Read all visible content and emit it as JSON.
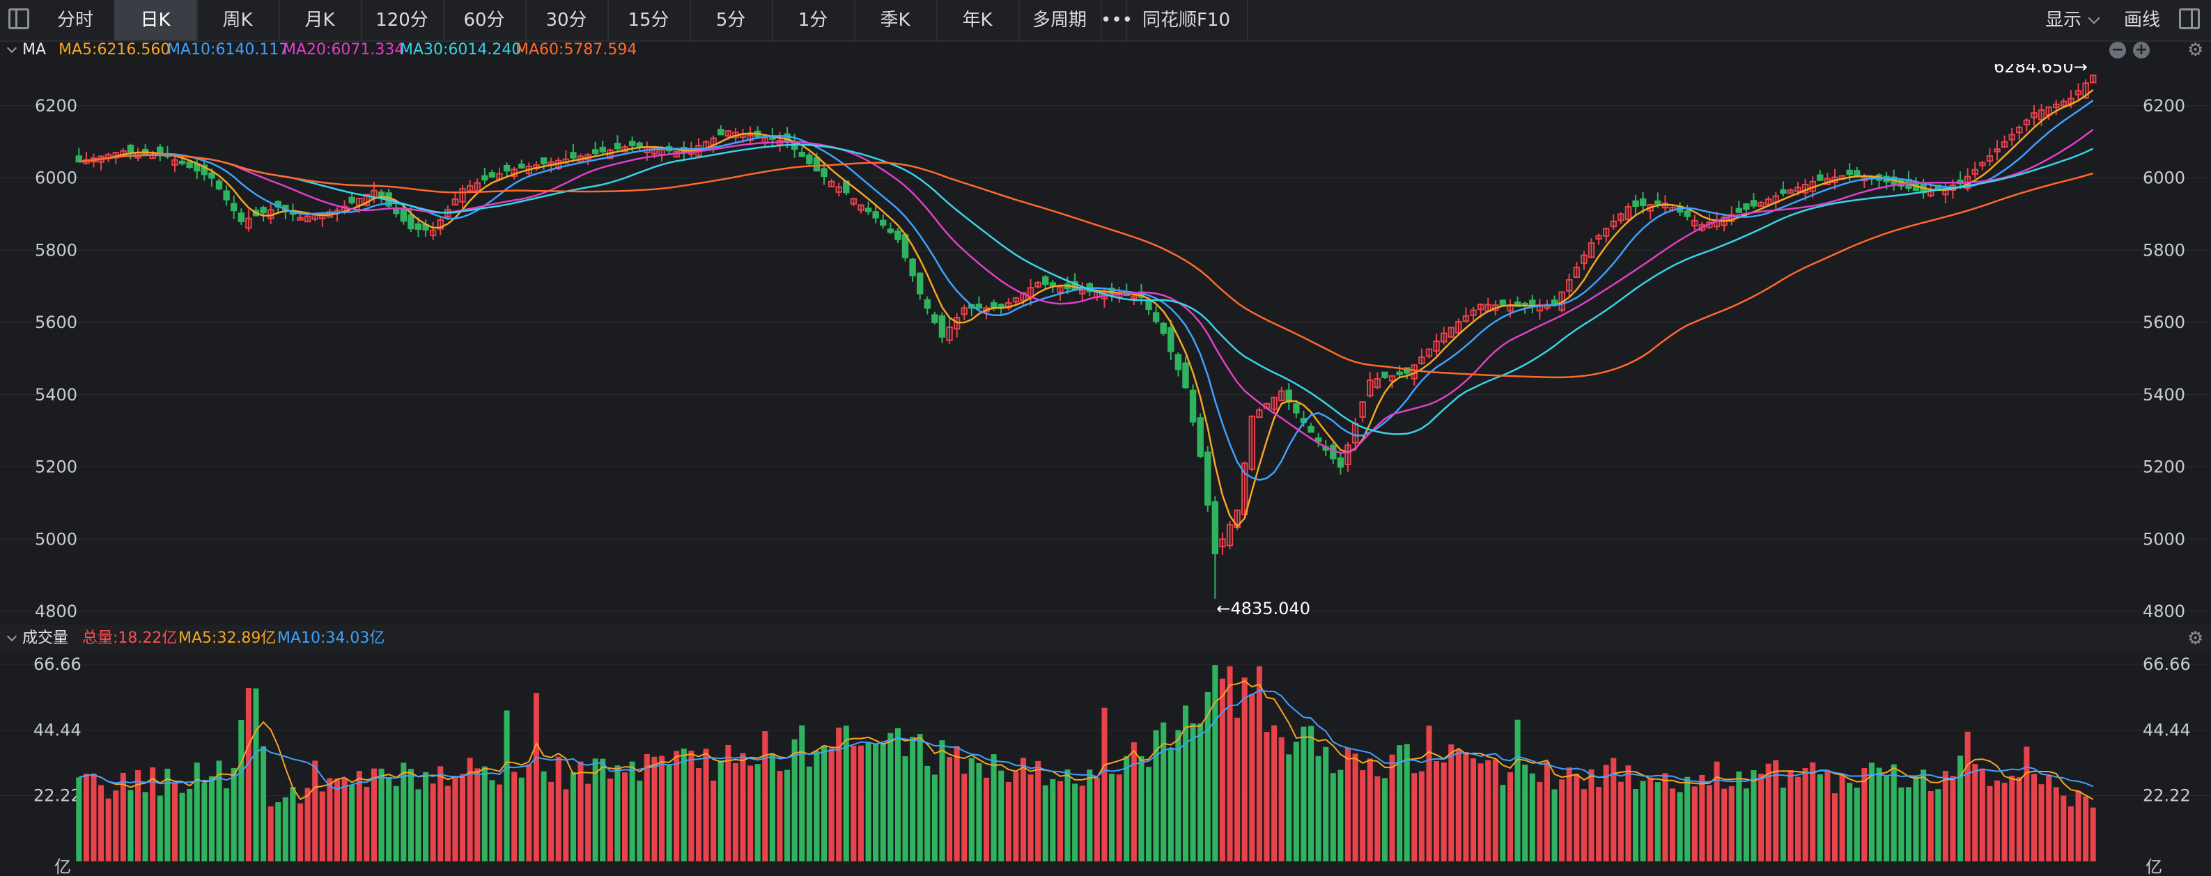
{
  "toolbar": {
    "tabs": [
      "分时",
      "日K",
      "周K",
      "月K",
      "120分",
      "60分",
      "30分",
      "15分",
      "5分",
      "1分",
      "季K",
      "年K",
      "多周期",
      "•••",
      "同花顺F10"
    ],
    "active_tab": "日K",
    "display_label": "显示",
    "draw_label": "画线"
  },
  "main_panel": {
    "label": "MA",
    "ma_legend": [
      {
        "text": "MA5:6216.560",
        "color": "#f5a623"
      },
      {
        "text": "MA10:6140.117",
        "color": "#3ea2ff"
      },
      {
        "text": "MA20:6071.334",
        "color": "#e040c8"
      },
      {
        "text": "MA30:6014.240",
        "color": "#39d3e8"
      },
      {
        "text": "MA60:5787.594",
        "color": "#ff6a2a"
      }
    ],
    "high_label": "6284.650→",
    "low_label": "←4835.040"
  },
  "volume_panel": {
    "label": "成交量",
    "legend": [
      {
        "text": "总量:18.22亿",
        "color": "#ff4d4f"
      },
      {
        "text": "MA5:32.89亿",
        "color": "#f5a623"
      },
      {
        "text": "MA10:34.03亿",
        "color": "#3ea2ff"
      }
    ],
    "unit": "亿"
  },
  "colors": {
    "up": "#e8424b",
    "down": "#2fb35f",
    "background": "#1b1c20",
    "grid": "#2a2c31"
  },
  "chart_data": [
    {
      "type": "candlestick",
      "ylim": [
        4800,
        6300
      ],
      "yticks": [
        "6200",
        "6000",
        "5800",
        "5600",
        "5400",
        "5200",
        "5000",
        "4800"
      ],
      "anchors": [
        [
          0,
          6045
        ],
        [
          6,
          6075
        ],
        [
          12,
          6060
        ],
        [
          18,
          6000
        ],
        [
          22,
          5880
        ],
        [
          27,
          5920
        ],
        [
          30,
          5890
        ],
        [
          35,
          5910
        ],
        [
          40,
          5965
        ],
        [
          45,
          5860
        ],
        [
          48,
          5855
        ],
        [
          52,
          5970
        ],
        [
          58,
          6020
        ],
        [
          63,
          6040
        ],
        [
          68,
          6060
        ],
        [
          75,
          6090
        ],
        [
          82,
          6070
        ],
        [
          88,
          6130
        ],
        [
          96,
          6100
        ],
        [
          100,
          6020
        ],
        [
          104,
          5960
        ],
        [
          108,
          5890
        ],
        [
          111,
          5830
        ],
        [
          114,
          5680
        ],
        [
          117,
          5560
        ],
        [
          120,
          5640
        ],
        [
          125,
          5640
        ],
        [
          130,
          5710
        ],
        [
          135,
          5690
        ],
        [
          140,
          5680
        ],
        [
          144,
          5670
        ],
        [
          147,
          5570
        ],
        [
          150,
          5420
        ],
        [
          152,
          5230
        ],
        [
          154,
          4960
        ],
        [
          157,
          5080
        ],
        [
          159,
          5340
        ],
        [
          163,
          5410
        ],
        [
          165,
          5350
        ],
        [
          168,
          5270
        ],
        [
          171,
          5200
        ],
        [
          175,
          5440
        ],
        [
          180,
          5460
        ],
        [
          185,
          5570
        ],
        [
          190,
          5650
        ],
        [
          195,
          5645
        ],
        [
          200,
          5650
        ],
        [
          205,
          5820
        ],
        [
          210,
          5920
        ],
        [
          215,
          5930
        ],
        [
          220,
          5870
        ],
        [
          225,
          5905
        ],
        [
          230,
          5950
        ],
        [
          235,
          5990
        ],
        [
          240,
          6010
        ],
        [
          245,
          5990
        ],
        [
          250,
          5960
        ],
        [
          255,
          5985
        ],
        [
          260,
          6080
        ],
        [
          265,
          6180
        ],
        [
          270,
          6220
        ],
        [
          273,
          6284
        ]
      ],
      "n": 274
    },
    {
      "type": "bar",
      "ylim": [
        0,
        66.66
      ],
      "yticks": [
        "66.66",
        "44.44",
        "22.22"
      ],
      "anchors": [
        [
          0,
          25
        ],
        [
          10,
          27
        ],
        [
          20,
          30
        ],
        [
          24,
          62
        ],
        [
          26,
          18
        ],
        [
          30,
          22
        ],
        [
          40,
          28
        ],
        [
          60,
          30
        ],
        [
          80,
          31
        ],
        [
          95,
          38
        ],
        [
          110,
          40
        ],
        [
          120,
          34
        ],
        [
          130,
          30
        ],
        [
          140,
          27
        ],
        [
          150,
          52
        ],
        [
          155,
          64
        ],
        [
          160,
          55
        ],
        [
          165,
          40
        ],
        [
          175,
          32
        ],
        [
          185,
          35
        ],
        [
          195,
          30
        ],
        [
          205,
          30
        ],
        [
          215,
          28
        ],
        [
          225,
          30
        ],
        [
          235,
          28
        ],
        [
          245,
          28
        ],
        [
          255,
          30
        ],
        [
          265,
          33
        ],
        [
          273,
          17
        ]
      ],
      "n": 274
    }
  ]
}
